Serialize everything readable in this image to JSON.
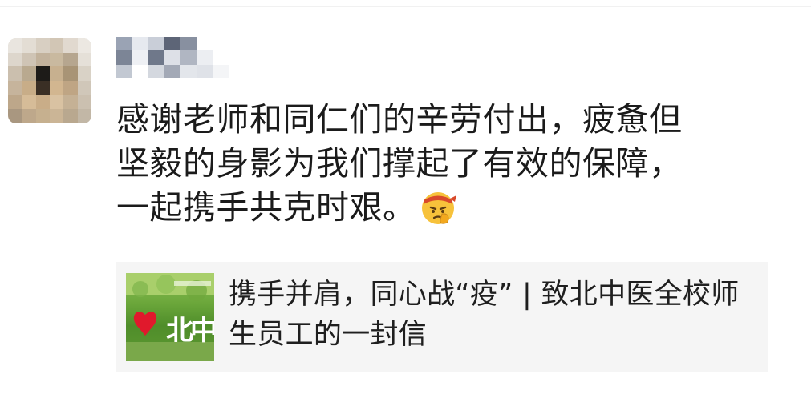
{
  "message": {
    "sender_name": "",
    "text": "感谢老师和同仁们的辛劳付出，疲惫但\n坚毅的身影为我们撑起了有效的保障，\n一起携手共克时艰。",
    "emoji": "facepalm-headband-emoji"
  },
  "link_card": {
    "title": "携手并肩，同心战“疫” | 致北中医全校师生员工的一封信",
    "thumbnail_text": "北中"
  },
  "colors": {
    "background": "#ffffff",
    "card_background": "#f5f5f5",
    "text": "#1b1b1b",
    "heart": "#e0192c"
  }
}
